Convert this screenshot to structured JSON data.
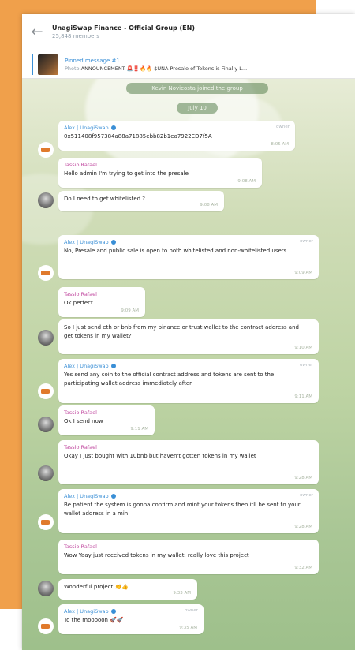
{
  "header": {
    "title": "UnagiSwap Finance - Official Group (EN)",
    "subtitle": "25,848 members"
  },
  "pinned": {
    "title": "Pinned message #1",
    "preview_prefix": "Photo",
    "preview_text": "ANNOUNCEMENT 🚨‼️🔥🔥 $UNA Presale of Tokens is Finally L..."
  },
  "service": {
    "joined": "Kevin Novicosta joined the group",
    "date": "July 10"
  },
  "messages": [
    {
      "sender": "Alex | UnagiSwap",
      "owner": "owner",
      "text": "0x511408f957384a88a71885ebb82b1ea7922ED7f5A",
      "time": "8:05 AM"
    },
    {
      "sender": "Tassio Rafael",
      "text": "Hello admin I'm trying to get into the presale",
      "time": "9:08 AM"
    },
    {
      "text": "Do I need to get whitelisted ?",
      "time": "9:08 AM"
    },
    {
      "sender": "Alex | UnagiSwap",
      "owner": "owner",
      "text": "No, Presale and public sale is open to both whitelisted and non-whitelisted users",
      "time": "9:09 AM"
    },
    {
      "sender": "Tassio Rafael",
      "text": "Ok perfect",
      "time": "9:09 AM"
    },
    {
      "text": "So I just send eth or bnb from my binance or trust wallet to the contract address and get tokens in my wallet?",
      "time": "9:10 AM"
    },
    {
      "sender": "Alex | UnagiSwap",
      "owner": "owner",
      "text": "Yes send any coin to the official contract address and tokens are sent to the participating wallet address immediately after",
      "time": "9:11 AM"
    },
    {
      "sender": "Tassio Rafael",
      "text": "Ok I send now",
      "time": "9:11 AM"
    },
    {
      "sender": "Tassio Rafael",
      "text": "Okay I just bought with 10bnb but haven't gotten tokens in my wallet",
      "time": "9:28 AM"
    },
    {
      "sender": "Alex | UnagiSwap",
      "owner": "owner",
      "text": "Be patient the system is gonna confirm and mint your tokens then itll be sent to your wallet address in a min",
      "time": "9:28 AM"
    },
    {
      "sender": "Tassio Rafael",
      "text": "Wow Yaay just received tokens in my wallet, really love this project",
      "time": "9:32 AM"
    },
    {
      "text": "Wonderful project 👏👍",
      "time": "9:33 AM"
    },
    {
      "sender": "Alex | UnagiSwap",
      "owner": "owner",
      "text": "To the mooooon 🚀🚀",
      "time": "9:35 AM"
    }
  ]
}
